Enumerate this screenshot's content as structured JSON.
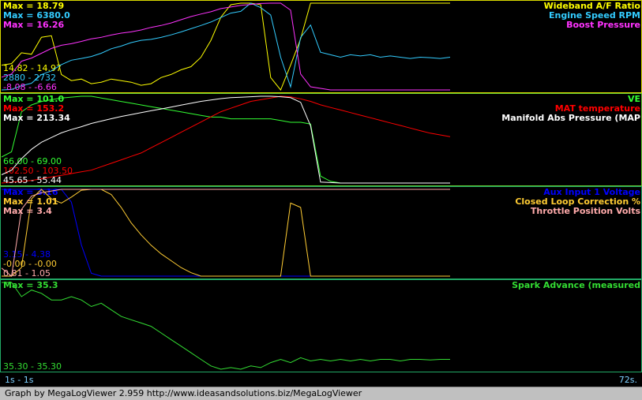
{
  "footer_text": "Graph by MegaLogViewer 2.959 http://www.ideasandsolutions.biz/MegaLogViewer",
  "time_start": "1s - 1s",
  "time_end": "72s.",
  "chart_data": [
    {
      "type": "line",
      "x_range": [
        1,
        72
      ],
      "series": [
        {
          "name": "Wideband A/F Ratio",
          "color": "#ffff00",
          "max_label": "Max = 18.79",
          "range_label": "14.82 - 14.97",
          "y": [
            14.8,
            14.9,
            15.6,
            15.5,
            16.6,
            16.7,
            14.2,
            13.8,
            13.9,
            13.6,
            13.7,
            13.9,
            13.8,
            13.7,
            13.5,
            13.6,
            14.0,
            14.2,
            14.5,
            14.7,
            15.3,
            16.4,
            17.9,
            18.7,
            18.8,
            18.8,
            18.7,
            14.0,
            13.2,
            14.8,
            16.5,
            18.8,
            18.8,
            18.8,
            18.8,
            18.8,
            18.8,
            18.8,
            18.8,
            18.8,
            18.8,
            18.8,
            18.8,
            18.8,
            18.8,
            18.8
          ]
        },
        {
          "name": "Engine Speed RPM",
          "color": "#33ccff",
          "max_label": "Max = 6380.0",
          "range_label": "2880 - 2732",
          "y": [
            2880,
            2900,
            3050,
            3150,
            3500,
            3650,
            3900,
            4080,
            4150,
            4230,
            4360,
            4540,
            4650,
            4790,
            4880,
            4920,
            5000,
            5100,
            5220,
            5350,
            5480,
            5620,
            5800,
            5980,
            6050,
            6380,
            6200,
            5900,
            4200,
            3000,
            5000,
            5500,
            4400,
            4300,
            4200,
            4300,
            4250,
            4300,
            4200,
            4250,
            4200,
            4150,
            4200,
            4180,
            4150,
            4200
          ]
        },
        {
          "name": "Boost Pressure",
          "color": "#ff33ff",
          "max_label": "Max = 16.26",
          "range_label": "-8.08 - -6.66",
          "y": [
            -7.0,
            -6.0,
            -2.0,
            -1.0,
            0.5,
            2.0,
            3.0,
            3.5,
            4.2,
            5.0,
            5.5,
            6.2,
            6.8,
            7.2,
            7.8,
            8.6,
            9.2,
            10.0,
            11.0,
            12.0,
            12.8,
            13.5,
            14.5,
            15.0,
            15.5,
            15.8,
            16.1,
            16.2,
            16.2,
            14.0,
            -6.0,
            -10.0,
            -10.5,
            -11.0,
            -11.0,
            -11.0,
            -11.0,
            -11.0,
            -11.0,
            -11.0,
            -11.0,
            -11.0,
            -11.0,
            -11.0,
            -11.0,
            -11.0
          ]
        }
      ]
    },
    {
      "type": "line",
      "x_range": [
        1,
        72
      ],
      "series": [
        {
          "name": "VE",
          "color": "#33ff33",
          "max_label": "Max = 101.0",
          "range_label": "66.00 - 69.00",
          "y": [
            66,
            69,
            92,
            96,
            98,
            99,
            100,
            100.5,
            101,
            101,
            100,
            99,
            98,
            97,
            96,
            95,
            94,
            93,
            92,
            91,
            90,
            89,
            89,
            88,
            88,
            88,
            88,
            88,
            87,
            86,
            86,
            85,
            55,
            52,
            51,
            51,
            51,
            51,
            51,
            51,
            51,
            51,
            51,
            51,
            51,
            51
          ]
        },
        {
          "name": "MAT temperature",
          "color": "#ff0000",
          "max_label": "Max = 153.2",
          "range_label": "102.50 - 103.50",
          "y": [
            102.5,
            103,
            103.5,
            104,
            105,
            106,
            107,
            108,
            109,
            110,
            112,
            114,
            116,
            118,
            120,
            123,
            126,
            129,
            132,
            135,
            138,
            141,
            144,
            146,
            148,
            150,
            151,
            152,
            153,
            152.7,
            151.5,
            150,
            148,
            146.5,
            145,
            143.5,
            142,
            140.5,
            139,
            137.5,
            136,
            134.5,
            133,
            131.5,
            130.5,
            129.5
          ]
        },
        {
          "name": "Manifold Abs Pressure (MAP",
          "color": "#ffffff",
          "max_label": "Max = 213.34",
          "range_label": "45.65 - 55.44",
          "y": [
            45.65,
            55.44,
            80,
            100,
            115,
            125,
            135,
            142,
            148,
            155,
            160,
            165,
            170,
            174,
            178,
            182,
            186,
            190,
            194,
            198,
            202,
            205,
            208,
            210,
            211,
            212,
            213,
            213,
            212,
            210,
            200,
            150,
            30,
            29,
            28,
            28,
            28,
            28,
            28,
            28,
            28,
            28,
            28,
            28,
            28,
            28
          ]
        }
      ]
    },
    {
      "type": "line",
      "x_range": [
        1,
        72
      ],
      "series": [
        {
          "name": "Aux Input 1 Voltage",
          "color": "#0000ff",
          "max_label": "Max = 3.16",
          "range_label": "3.15 - 4.38",
          "y": [
            4.38,
            4.38,
            4.38,
            4.38,
            4.38,
            4.38,
            4.38,
            4.2,
            3.6,
            3.2,
            3.16,
            3.16,
            3.16,
            3.16,
            3.16,
            3.16,
            3.16,
            3.16,
            3.16,
            3.16,
            3.16,
            3.16,
            3.16,
            3.16,
            3.16,
            3.16,
            3.16,
            3.16,
            3.16,
            3.16,
            3.16,
            3.16,
            3.16,
            3.16,
            3.16,
            3.16,
            3.16,
            3.16,
            3.16,
            3.16,
            3.16,
            3.16,
            3.16,
            3.16,
            3.16,
            3.16
          ]
        },
        {
          "name": "Closed Loop Correction %",
          "color": "#ffcc33",
          "max_label": "Max = 1.01",
          "range_label": "-0.00 - -0.00",
          "y": [
            0.0,
            0.0,
            0.1,
            0.9,
            1.01,
            0.9,
            0.85,
            0.92,
            1.0,
            1.01,
            1.01,
            0.95,
            0.8,
            0.62,
            0.48,
            0.36,
            0.26,
            0.18,
            0.1,
            0.04,
            0.0,
            0.0,
            0.0,
            0.0,
            0.0,
            0.0,
            0.0,
            0.0,
            0.0,
            0.85,
            0.8,
            0.0,
            0.0,
            0.0,
            0.0,
            0.0,
            0.0,
            0.0,
            0.0,
            0.0,
            0.0,
            0.0,
            0.0,
            0.0,
            0.0,
            0.0
          ]
        },
        {
          "name": "Throttle Position Volts",
          "color": "#ffaaaa",
          "max_label": "Max = 3.4",
          "range_label": "0.81 - 1.05",
          "y": [
            1.05,
            0.81,
            2.8,
            3.2,
            3.3,
            3.35,
            3.4,
            3.4,
            3.4,
            3.4,
            3.4,
            3.4,
            3.4,
            3.4,
            3.4,
            3.4,
            3.4,
            3.4,
            3.4,
            3.4,
            3.4,
            3.4,
            3.4,
            3.4,
            3.4,
            3.4,
            3.4,
            3.4,
            3.4,
            3.4,
            3.4,
            3.4,
            3.4,
            3.4,
            3.4,
            3.4,
            3.4,
            3.4,
            3.4,
            3.4,
            3.4,
            3.4,
            3.4,
            3.4,
            3.4,
            3.4
          ]
        }
      ]
    },
    {
      "type": "line",
      "x_range": [
        1,
        72
      ],
      "series": [
        {
          "name": "Spark Advance (measured",
          "color": "#33dd33",
          "max_label": "Max = 35.3",
          "range_label": "35.30 - 35.30",
          "y": [
            35.3,
            35.3,
            31,
            33,
            32,
            30,
            30,
            31,
            30,
            28,
            29,
            27,
            25,
            24,
            23,
            22,
            20,
            18,
            16,
            14,
            12,
            10,
            9,
            9.5,
            9,
            10,
            9.5,
            11,
            12,
            11,
            12.5,
            11.5,
            12,
            11.5,
            12,
            11.5,
            12,
            11.5,
            12,
            12,
            11.5,
            12,
            12,
            11.8,
            12,
            12
          ]
        }
      ]
    }
  ]
}
